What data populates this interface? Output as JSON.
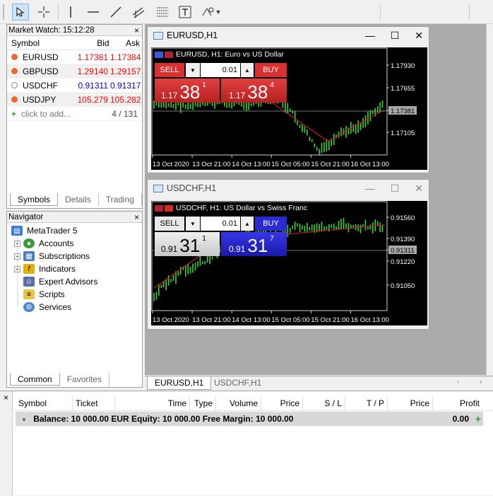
{
  "market_watch": {
    "title": "Market Watch: 15:12:28",
    "columns": [
      "Symbol",
      "Bid",
      "Ask"
    ],
    "rows": [
      {
        "symbol": "EURUSD",
        "bid": "1.17381",
        "ask": "1.17384",
        "color": "#ff0000",
        "icon": "up-down-arrow-icon"
      },
      {
        "symbol": "GBPUSD",
        "bid": "1.29140",
        "ask": "1.29157",
        "color": "#ff0000",
        "icon": "up-down-arrow-icon"
      },
      {
        "symbol": "USDCHF",
        "bid": "0.91311",
        "ask": "0.91317",
        "color": "#0000cc",
        "icon": "circle-icon"
      },
      {
        "symbol": "USDJPY",
        "bid": "105.279",
        "ask": "105.282",
        "color": "#ff0000",
        "icon": "up-down-arrow-icon"
      }
    ],
    "add_label": "click to add...",
    "count": "4 / 131",
    "tabs": [
      "Symbols",
      "Details",
      "Trading"
    ]
  },
  "navigator": {
    "title": "Navigator",
    "root": "MetaTrader 5",
    "items": [
      "Accounts",
      "Subscriptions",
      "Indicators",
      "Expert Advisors",
      "Scripts",
      "Services"
    ],
    "tabs": [
      "Common",
      "Favorites"
    ]
  },
  "charts": [
    {
      "window_title": "EURUSD,H1",
      "info": "EURUSD, H1:  Euro vs US Dollar",
      "sell": "SELL",
      "buy": "BUY",
      "volume": "0.01",
      "bid_prefix": "1.17",
      "bid_big": "38",
      "bid_sup": "1",
      "ask_prefix": "1.17",
      "ask_big": "38",
      "ask_sup": "4",
      "price_labels": [
        "1.17930",
        "1.17655",
        "1.17381",
        "1.17105"
      ],
      "time_labels": [
        "13 Oct 2020",
        "13 Oct 21:00",
        "14 Oct 13:00",
        "15 Oct 05:00",
        "15 Oct 21:00",
        "16 Oct 13:00"
      ]
    },
    {
      "window_title": "USDCHF,H1",
      "info": "USDCHF, H1:  US Dollar vs Swiss Franc",
      "sell": "SELL",
      "buy": "BUY",
      "volume": "0.01",
      "bid_prefix": "0.91",
      "bid_big": "31",
      "bid_sup": "1",
      "ask_prefix": "0.91",
      "ask_big": "31",
      "ask_sup": "7",
      "price_labels": [
        "0.91560",
        "0.91390",
        "0.91311",
        "0.91220",
        "0.91050"
      ],
      "time_labels": [
        "13 Oct 2020",
        "13 Oct 21:00",
        "14 Oct 13:00",
        "15 Oct 05:00",
        "15 Oct 21:00",
        "16 Oct 13:00"
      ]
    }
  ],
  "chart_tabs": [
    "EURUSD,H1",
    "USDCHF,H1"
  ],
  "toolbox": {
    "columns": [
      "Symbol",
      "Ticket",
      "Time",
      "Type",
      "Volume",
      "Price",
      "S / L",
      "T / P",
      "Price",
      "Profit"
    ],
    "balance_text": "Balance: 10 000.00 EUR  Equity: 10 000.00  Free Margin: 10 000.00",
    "profit_total": "0.00"
  }
}
